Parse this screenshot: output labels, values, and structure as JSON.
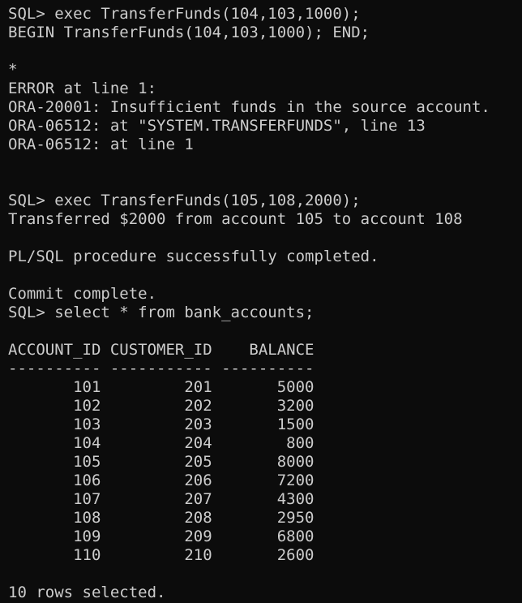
{
  "terminal": {
    "lines": [
      "SQL> exec TransferFunds(104,103,1000);",
      "BEGIN TransferFunds(104,103,1000); END;",
      "",
      "*",
      "ERROR at line 1:",
      "ORA-20001: Insufficient funds in the source account.",
      "ORA-06512: at \"SYSTEM.TRANSFERFUNDS\", line 13",
      "ORA-06512: at line 1",
      "",
      "",
      "SQL> exec TransferFunds(105,108,2000);",
      "Transferred $2000 from account 105 to account 108",
      "",
      "PL/SQL procedure successfully completed.",
      "",
      "Commit complete.",
      "SQL> select * from bank_accounts;",
      "",
      "ACCOUNT_ID CUSTOMER_ID    BALANCE",
      "---------- ----------- ----------",
      "       101         201       5000",
      "       102         202       3200",
      "       103         203       1500",
      "       104         204        800",
      "       105         205       8000",
      "       106         206       7200",
      "       107         207       4300",
      "       108         208       2950",
      "       109         209       6800",
      "       110         210       2600",
      "",
      "10 rows selected."
    ]
  }
}
